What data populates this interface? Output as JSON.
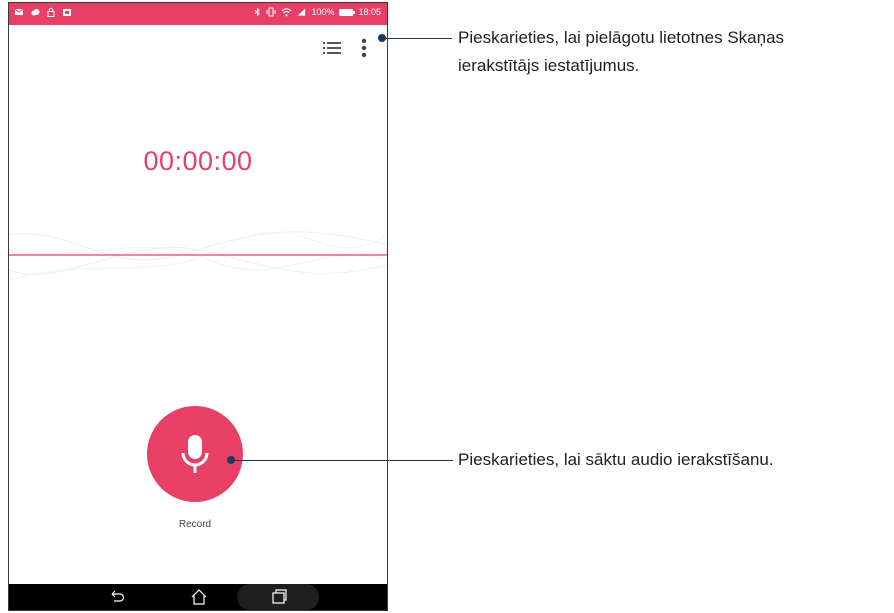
{
  "status_bar": {
    "battery": "100%",
    "time": "18:05"
  },
  "timer": "00:00:00",
  "record": {
    "label": "Record"
  },
  "callouts": {
    "settings_line1": "Pieskarieties, lai pielāgotu lietotnes Skaņas",
    "settings_line2": "ierakstītājs iestatījumus.",
    "record": "Pieskarieties, lai sāktu audio ierakstīšanu."
  },
  "colors": {
    "accent": "#e83f67",
    "callout_line": "#1a3a5c"
  }
}
